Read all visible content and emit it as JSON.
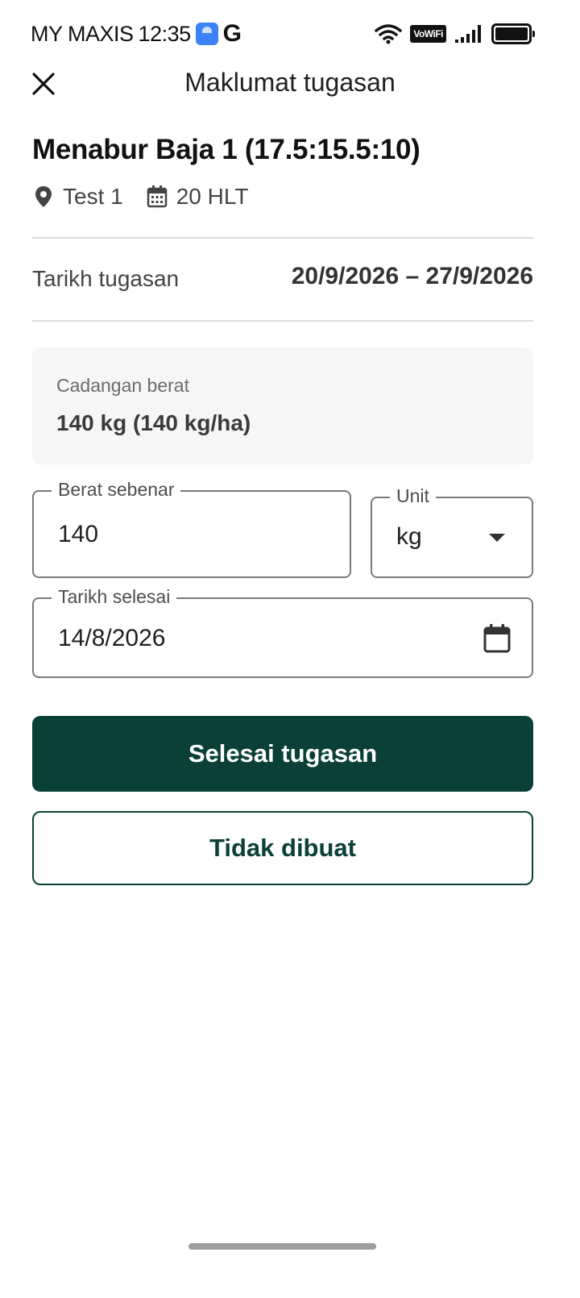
{
  "status_bar": {
    "carrier": "MY MAXIS",
    "time": "12:35",
    "google_glyph": "G",
    "vowifi": "VoWiFi"
  },
  "header": {
    "title": "Maklumat tugasan",
    "close_icon": "close-icon"
  },
  "task": {
    "title": "Menabur Baja 1 (17.5:15.5:10)",
    "location": "Test 1",
    "days": "20 HLT"
  },
  "date_row": {
    "label": "Tarikh tugasan",
    "value": "20/9/2026 – 27/9/2026"
  },
  "suggestion": {
    "label": "Cadangan berat",
    "value": "140 kg (140 kg/ha)"
  },
  "form": {
    "actual_weight": {
      "label": "Berat sebenar",
      "value": "140"
    },
    "unit": {
      "label": "Unit",
      "value": "kg"
    },
    "completion_date": {
      "label": "Tarikh selesai",
      "value": "14/8/2026"
    }
  },
  "actions": {
    "complete": "Selesai tugasan",
    "not_done": "Tidak dibuat"
  },
  "colors": {
    "primary": "#0a4037",
    "card_bg": "#f6f6f6"
  }
}
